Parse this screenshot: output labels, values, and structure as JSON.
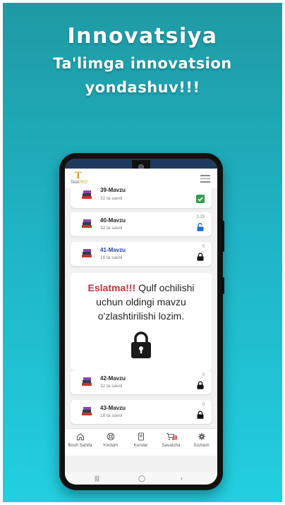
{
  "headline": {
    "line1": "Innovatsiya",
    "line2": "Ta'limga innovatsion",
    "line3": "yondashuv!!!"
  },
  "app": {
    "logo_mark": "T",
    "logo_text_a": "Test",
    "logo_text_b": "PRO"
  },
  "topics": [
    {
      "title": "39-Mavzu",
      "subtitle": "32 ta savol",
      "meta": "",
      "status": "completed",
      "title_color": "#222222"
    },
    {
      "title": "40-Mavzu",
      "subtitle": "32 ta savol",
      "meta": "3.33",
      "status": "unlocked",
      "title_color": "#222222"
    },
    {
      "title": "41-Mavzu",
      "subtitle": "16 ta savol",
      "meta": "0",
      "status": "locked",
      "title_color": "#2343a8"
    },
    {
      "title": "42-Mavzu",
      "subtitle": "32 ta savol",
      "meta": "0",
      "status": "locked",
      "title_color": "#222222"
    },
    {
      "title": "43-Mavzu",
      "subtitle": "18 ta savol",
      "meta": "0",
      "status": "locked",
      "title_color": "#222222"
    }
  ],
  "dialog": {
    "warning": "Eslatma!!!",
    "message": "Qulf ochilishi uchun oldingi mavzu o'zlashtirilishi lozim."
  },
  "tabs": [
    {
      "label": "Bosh Sahifa",
      "icon": "home-icon"
    },
    {
      "label": "Yordam",
      "icon": "help-icon"
    },
    {
      "label": "Kurslar",
      "icon": "courses-icon"
    },
    {
      "label": "Savatcha",
      "icon": "cart-icon",
      "badge": "0"
    },
    {
      "label": "Sozlash",
      "icon": "settings-icon"
    }
  ],
  "colors": {
    "accent": "#d9a21b",
    "warning": "#c6323d",
    "completed": "#2e9e4f",
    "unlocked": "#1e6fd9",
    "background_top": "#1f9aa4",
    "background_bottom": "#22cfe0"
  }
}
